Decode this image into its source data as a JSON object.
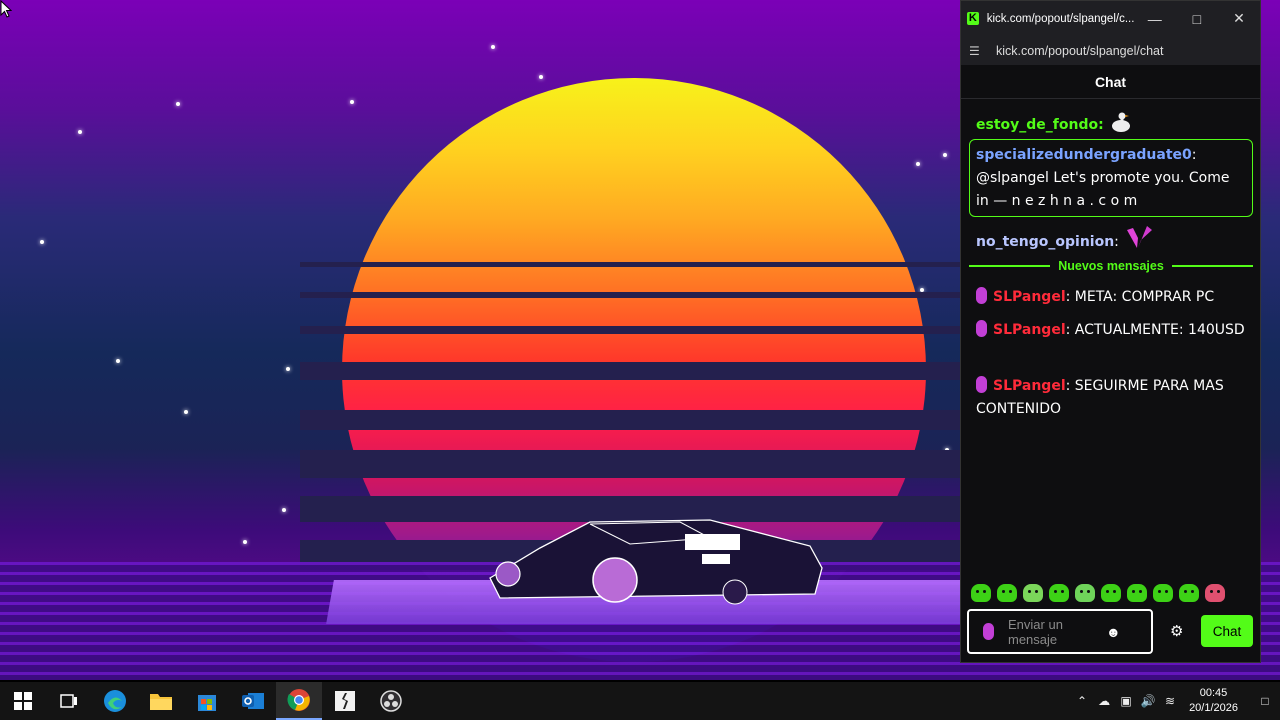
{
  "browser": {
    "title": "kick.com/popout/slpangel/c...",
    "url": "kick.com/popout/slpangel/chat",
    "minimize_icon": "minimize-icon",
    "maximize_icon": "maximize-icon",
    "close_icon": "close-icon"
  },
  "chat": {
    "header": "Chat",
    "messages": [
      {
        "user": "estoy_de_fondo",
        "sep": ":",
        "text": "",
        "emote": "goose-emote"
      },
      {
        "user": "specializedundergraduate0",
        "sep": ":",
        "text": "@slpangel Let's promote you. Come in — n e z h n a . c o  m"
      },
      {
        "user": "no_tengo_opinion",
        "sep": ":",
        "text": "",
        "emote": "pink-wings-emote"
      },
      {
        "user": "SLPangel",
        "sep": ":",
        "text": "META: COMPRAR PC"
      },
      {
        "user": "SLPangel",
        "sep": ":",
        "text": "ACTUALMENTE: 140USD"
      },
      {
        "user": "SLPangel",
        "sep": ":",
        "text": "SEGUIRME PARA MAS CONTENIDO"
      }
    ],
    "divider": "Nuevos mensajes",
    "input_placeholder": "Enviar un mensaje",
    "send_label": "Chat",
    "colors": {
      "accent": "#53fc18",
      "streamer": "#ff2b3a",
      "highlight_user": "#7aa3ff"
    }
  },
  "taskbar": {
    "icons": [
      "windows-start-icon",
      "task-view-icon",
      "edge-icon",
      "file-explorer-icon",
      "store-icon",
      "outlook-icon",
      "chrome-icon",
      "game-app-icon",
      "obs-icon"
    ],
    "time": "00:45",
    "date": "20/1/2026"
  }
}
